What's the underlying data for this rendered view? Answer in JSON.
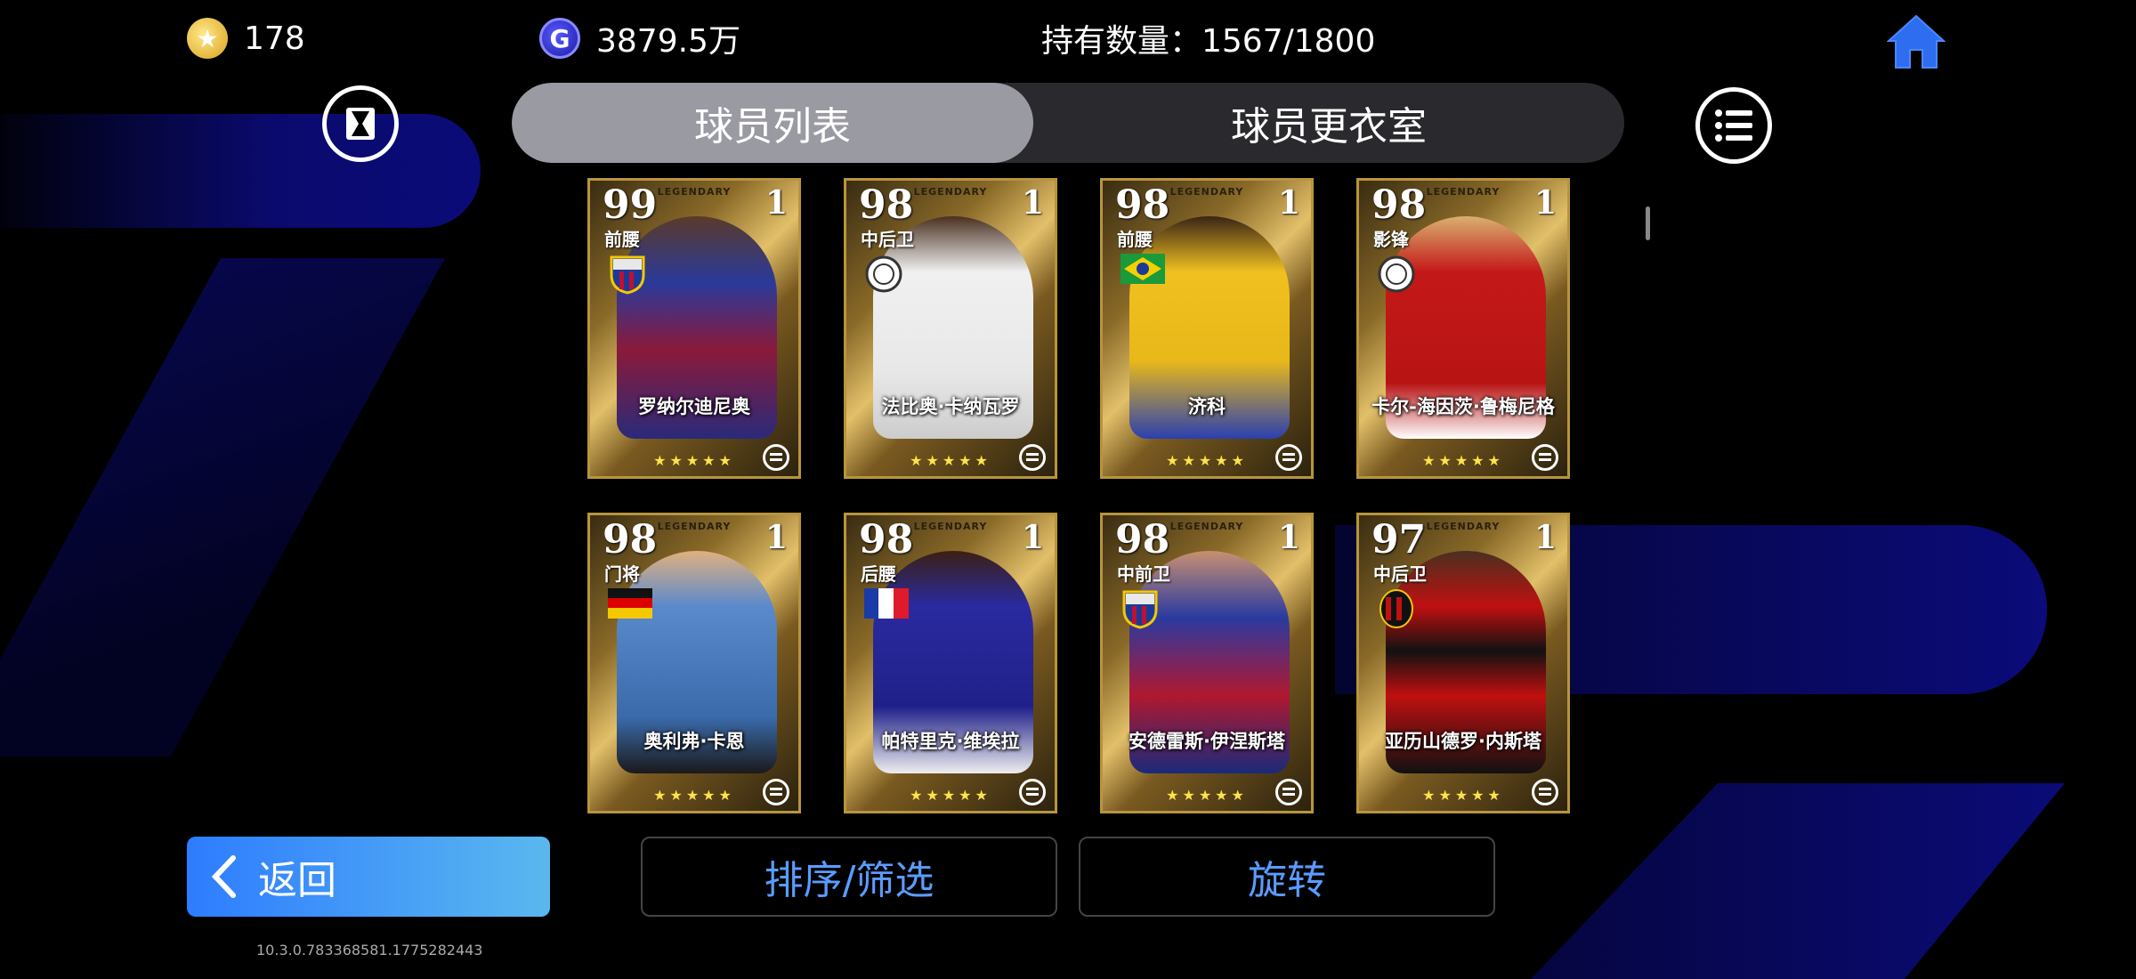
{
  "header": {
    "coins": "178",
    "gp": "3879.5万",
    "holdings": "持有数量：1567/1800"
  },
  "tabs": [
    {
      "label": "球员列表",
      "active": true
    },
    {
      "label": "球员更衣室",
      "active": false
    }
  ],
  "cards": [
    {
      "rating": "99",
      "level": "1",
      "position": "前腰",
      "name": "罗纳尔迪尼奥",
      "emblem": "barcelona-crest",
      "stars": "★★★★★",
      "legend_label": "LEGENDARY"
    },
    {
      "rating": "98",
      "level": "1",
      "position": "中后卫",
      "name": "法比奥·卡纳瓦罗",
      "emblem": "club-crest",
      "stars": "★★★★★",
      "legend_label": "LEGENDARY"
    },
    {
      "rating": "98",
      "level": "1",
      "position": "前腰",
      "name": "济科",
      "emblem": "brazil-flag",
      "stars": "★★★★★",
      "legend_label": "LEGENDARY"
    },
    {
      "rating": "98",
      "level": "1",
      "position": "影锋",
      "name": "卡尔-海因茨·鲁梅尼格",
      "emblem": "club-crest",
      "stars": "★★★★★",
      "legend_label": "LEGENDARY"
    },
    {
      "rating": "98",
      "level": "1",
      "position": "门将",
      "name": "奥利弗·卡恩",
      "emblem": "germany-flag",
      "stars": "★★★★★",
      "legend_label": "LEGENDARY"
    },
    {
      "rating": "98",
      "level": "1",
      "position": "后腰",
      "name": "帕特里克·维埃拉",
      "emblem": "france-flag",
      "stars": "★★★★★",
      "legend_label": "LEGENDARY"
    },
    {
      "rating": "98",
      "level": "1",
      "position": "中前卫",
      "name": "安德雷斯·伊涅斯塔",
      "emblem": "barcelona-crest",
      "stars": "★★★★★",
      "legend_label": "LEGENDARY"
    },
    {
      "rating": "97",
      "level": "1",
      "position": "中后卫",
      "name": "亚历山德罗·内斯塔",
      "emblem": "milan-crest",
      "stars": "★★★★★",
      "legend_label": "LEGENDARY"
    }
  ],
  "buttons": {
    "back": "返回",
    "sort_filter": "排序/筛选",
    "rotate": "旋转"
  },
  "version": "10.3.0.783368581.1775282443",
  "colors": {
    "accent_blue": "#2e7cff",
    "button_text_blue": "#5a9cff",
    "card_gold": "#b8953d"
  }
}
